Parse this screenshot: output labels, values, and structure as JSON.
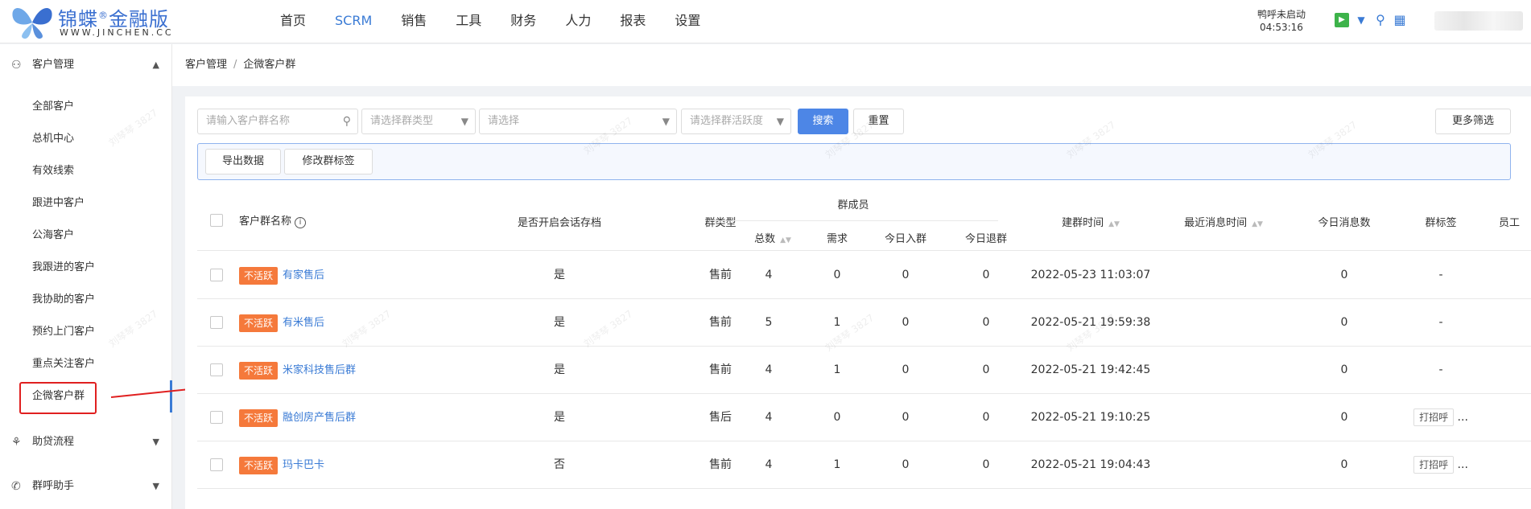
{
  "brand": {
    "name": "锦蝶",
    "reg": "®",
    "edition": "金融版",
    "domain": "WWW.JINCHEN.CC"
  },
  "nav": [
    "首页",
    "SCRM",
    "销售",
    "工具",
    "财务",
    "人力",
    "报表",
    "设置"
  ],
  "nav_active": "SCRM",
  "call": {
    "status": "鸭呼未启动",
    "time": "04:53:16"
  },
  "sidebar": {
    "group1": "客户管理",
    "items": [
      "全部客户",
      "总机中心",
      "有效线索",
      "跟进中客户",
      "公海客户",
      "我跟进的客户",
      "我协助的客户",
      "预约上门客户",
      "重点关注客户",
      "企微客户群"
    ],
    "group2": "助贷流程",
    "group3": "群呼助手"
  },
  "breadcrumb": {
    "parent": "客户管理",
    "sep": "/",
    "current": "企微客户群"
  },
  "filters": {
    "name_placeholder": "请输入客户群名称",
    "type_placeholder": "请选择群类型",
    "select_placeholder": "请选择",
    "activity_placeholder": "请选择群活跃度",
    "search": "搜索",
    "reset": "重置",
    "more": "更多筛选"
  },
  "actions": {
    "export": "导出数据",
    "edit_tags": "修改群标签"
  },
  "table": {
    "headers": {
      "name": "客户群名称",
      "archive": "是否开启会话存档",
      "type": "群类型",
      "members": "群成员",
      "total": "总数",
      "need": "需求",
      "join_today": "今日入群",
      "quit_today": "今日退群",
      "created": "建群时间",
      "last_msg": "最近消息时间",
      "msgs_today": "今日消息数",
      "tag": "群标签",
      "staff": "员工"
    },
    "rows": [
      {
        "status": "不活跃",
        "name": "有家售后",
        "archive": "是",
        "type": "售前",
        "total": "4",
        "need": "0",
        "join": "0",
        "quit": "0",
        "created": "2022-05-23 11:03:07",
        "msgs": "0",
        "tag": "-"
      },
      {
        "status": "不活跃",
        "name": "有米售后",
        "archive": "是",
        "type": "售前",
        "total": "5",
        "need": "1",
        "join": "0",
        "quit": "0",
        "created": "2022-05-21 19:59:38",
        "msgs": "0",
        "tag": "-"
      },
      {
        "status": "不活跃",
        "name": "米家科技售后群",
        "archive": "是",
        "type": "售前",
        "total": "4",
        "need": "1",
        "join": "0",
        "quit": "0",
        "created": "2022-05-21 19:42:45",
        "msgs": "0",
        "tag": "-"
      },
      {
        "status": "不活跃",
        "name": "融创房产售后群",
        "archive": "是",
        "type": "售后",
        "total": "4",
        "need": "0",
        "join": "0",
        "quit": "0",
        "created": "2022-05-21 19:10:25",
        "msgs": "0",
        "tag": "打招呼",
        "more": "..."
      },
      {
        "status": "不活跃",
        "name": "玛卡巴卡",
        "archive": "否",
        "type": "售前",
        "total": "4",
        "need": "1",
        "join": "0",
        "quit": "0",
        "created": "2022-05-21 19:04:43",
        "msgs": "0",
        "tag": "打招呼",
        "more": "..."
      }
    ]
  },
  "watermark": "刘琴琴 3827",
  "colors": {
    "accent": "#3a7bd5",
    "inactive_tag": "#f5793b",
    "highlight": "#e02020"
  }
}
